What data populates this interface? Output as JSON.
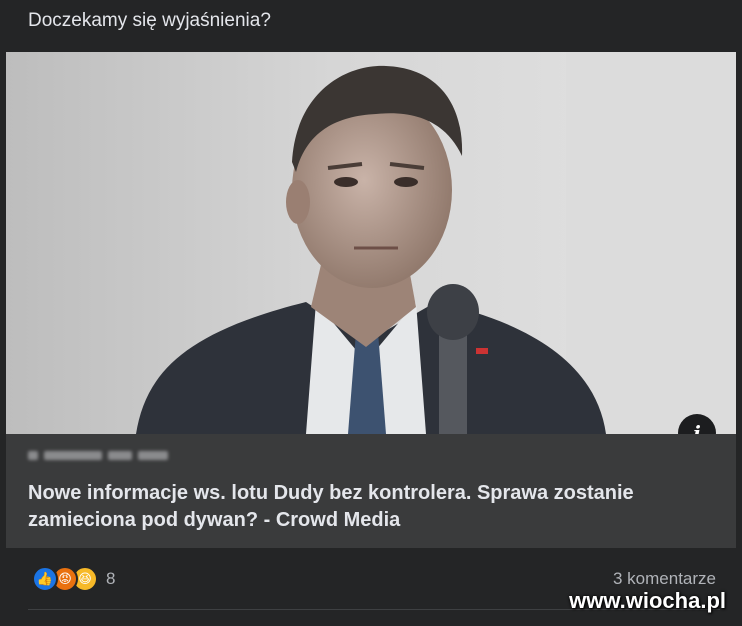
{
  "post": {
    "text": "Doczekamy się wyjaśnienia?"
  },
  "link": {
    "domain_blurred": "CROWDMEDIA.PL",
    "title": "Nowe informacje ws. lotu Dudy bez kontrolera. Sprawa zostanie zamieciona pod dywan? - Crowd Media",
    "info_icon": "info-icon"
  },
  "footer": {
    "reaction_count": "8",
    "comments": "3 komentarze",
    "reactions": [
      "like",
      "angry",
      "haha"
    ]
  },
  "watermark": "www.wiocha.pl",
  "colors": {
    "background": "#242526",
    "link_box": "#3a3b3c",
    "text": "#e4e6eb",
    "muted": "#b0b3b8",
    "like": "#1b74e4",
    "angry": "#e9710f",
    "haha": "#f7b928"
  }
}
